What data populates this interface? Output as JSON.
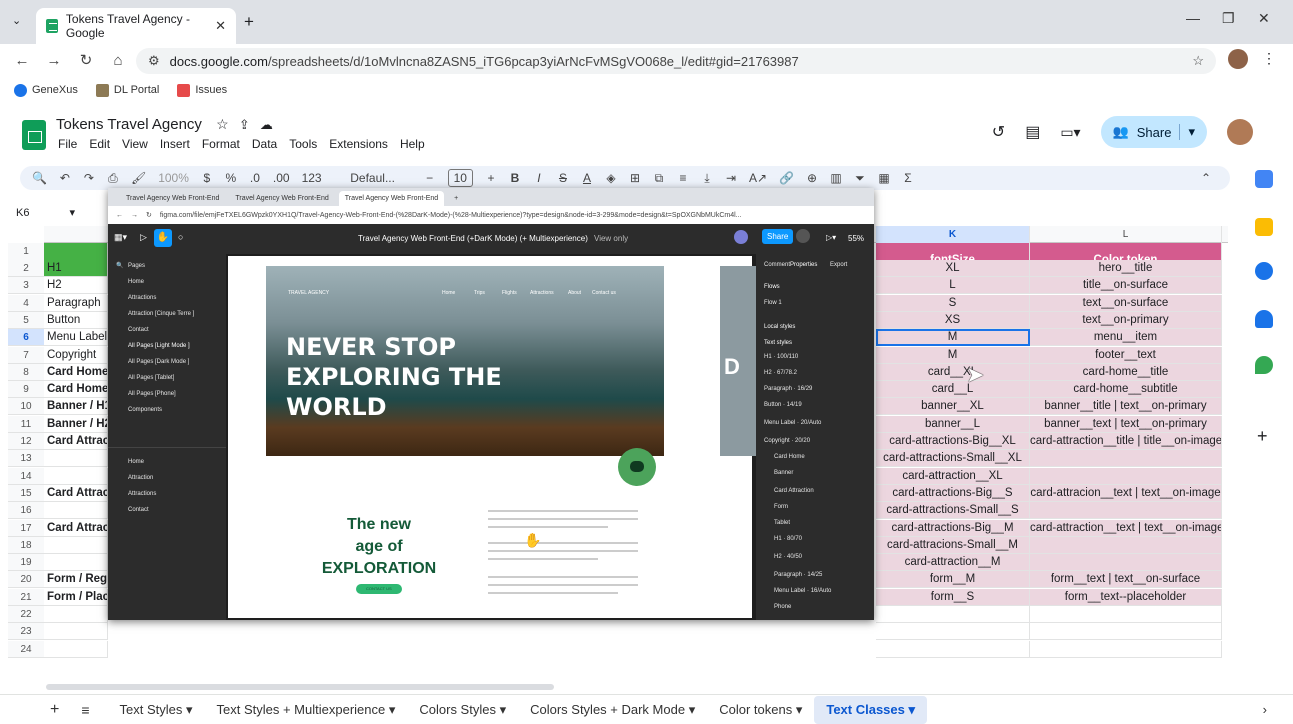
{
  "browser": {
    "tab_title": "Tokens Travel Agency - Google",
    "url_host": "docs.google.com",
    "url_path": "/spreadsheets/d/1oMvlncna8ZASN5_iTG6pcap3yiArNcFvMSgVO068e_l/edit#gid=21763987",
    "bookmarks": [
      "GeneXus",
      "DL Portal",
      "Issues"
    ]
  },
  "sheets": {
    "doc_title": "Tokens Travel Agency",
    "menu": [
      "File",
      "Edit",
      "View",
      "Insert",
      "Format",
      "Data",
      "Tools",
      "Extensions",
      "Help"
    ],
    "share_label": "Share",
    "toolbar": {
      "zoom": "100%",
      "font": "Defaul...",
      "font_size": "10",
      "currency": "$",
      "percent": "%",
      "dec_less": ".0",
      "dec_more": ".00",
      "num_format": "123"
    },
    "name_box": "K6",
    "columns": {
      "K": "K",
      "L": "L"
    },
    "header_K": "fontSize",
    "header_L": "Color token",
    "row_numbers": [
      "1",
      "2",
      "3",
      "4",
      "5",
      "6",
      "7",
      "8",
      "9",
      "10",
      "11",
      "12",
      "13",
      "14",
      "15",
      "16",
      "17",
      "18",
      "19",
      "20",
      "21",
      "22",
      "23",
      "24"
    ],
    "col_a": [
      "",
      "H1",
      "H2",
      "Paragraph",
      "Button",
      "Menu Label",
      "Copyright",
      "Card Home",
      "Card Home",
      "Banner / H1",
      "Banner / H2",
      "Card Attrac",
      "",
      "",
      "Card Attrac",
      "",
      "Card Attrac",
      "",
      "",
      "Form / Regu",
      "Form / Place",
      "",
      "",
      ""
    ],
    "col_k": [
      "",
      "XL",
      "L",
      "S",
      "XS",
      "M",
      "M",
      "card__XL",
      "card__L",
      "banner__XL",
      "banner__L",
      "card-attractions-Big__XL",
      "card-attractions-Small__XL",
      "card-attraction__XL",
      "card-attractions-Big__S",
      "card-attractions-Small__S",
      "card-attractions-Big__M",
      "card-attracions-Small__M",
      "card-attraction__M",
      "form__M",
      "form__S",
      "",
      "",
      ""
    ],
    "col_l": [
      "",
      "hero__title",
      "title__on-surface",
      "text__on-surface",
      "text__on-primary",
      "menu__item",
      "footer__text",
      "card-home__title",
      "card-home__subtitle",
      "banner__title | text__on-primary",
      "banner__text | text__on-primary",
      "card-attraction__title | title__on-image",
      "",
      "",
      "card-attracion__text | text__on-image",
      "",
      "card-attraction__text | text__on-image",
      "",
      "",
      "form__text | text__on-surface",
      "form__text--placeholder",
      "",
      "",
      ""
    ],
    "sheet_tabs": [
      "Text Styles",
      "Text Styles + Multiexperience",
      "Colors Styles",
      "Colors Styles + Dark Mode",
      "Color tokens",
      "Text Classes"
    ]
  },
  "figma": {
    "tabs": [
      "Travel Agency Web Front-End",
      "Travel Agency Web Front-End",
      "Travel Agency Web Front-End"
    ],
    "url": "figma.com/file/emjFeTXEL6GWpzk0YXH1Q/Travel-Agency-Web-Front-End-(%28DarK-Mode)-(%28-Multiexperience)?type=design&node-id=3-299&mode=design&t=SpOXGNbMUkCm4l...",
    "file_title": "Travel Agency Web Front-End (+DarK Mode) (+ Multiexperience)",
    "view_only": "View only",
    "share": "Share",
    "zoom": "55%",
    "pages_label": "Pages",
    "pages": [
      "Home",
      "Attractions",
      "Attraction [Cinque Terre ]",
      "Contact",
      "All Pages [Light Mode ]",
      "All Pages [Dark Mode ]",
      "All Pages [Tablet]",
      "All Pages [Phone]",
      "Components"
    ],
    "layers": [
      "Home",
      "Attraction",
      "Attractions",
      "Contact"
    ],
    "right_tabs": [
      "Comment",
      "Properties",
      "Export"
    ],
    "flows_label": "Flows",
    "flow1": "Flow 1",
    "local_styles": "Local styles",
    "text_styles": "Text styles",
    "styles": [
      "H1 · 100/110",
      "H2 · 67/78.2",
      "Paragraph · 16/29",
      "Button · 14/19",
      "Menu Label · 20/Auto",
      "Copyright · 20/20",
      "Card Home",
      "Banner",
      "Card Attraction",
      "Form",
      "Tablet",
      "H1 · 80/70",
      "H2 · 40/50",
      "Paragraph · 14/25",
      "Menu Label · 16/Auto",
      "Phone"
    ],
    "hero_title": "NEVER STOP\nEXPLORING THE\nWORLD",
    "hero_nav": [
      "Home",
      "Trips",
      "Flights",
      "Attractions",
      "About",
      "Contact us"
    ],
    "logo": "TRAVEL AGENCY",
    "new_age": "The new\nage of\nEXPLORATION",
    "button": "CONTACT US",
    "second_frame_letter": "D"
  }
}
